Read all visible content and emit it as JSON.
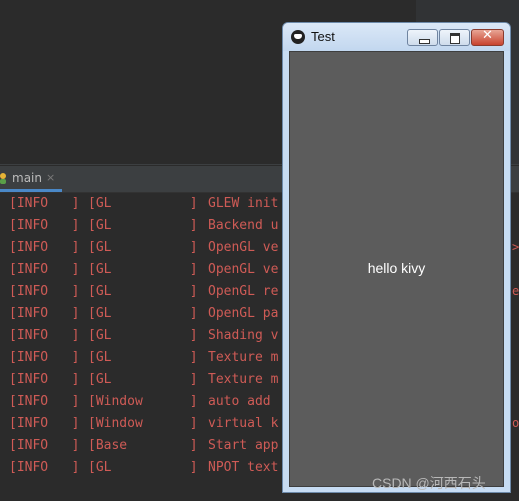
{
  "run_tab": {
    "label": "main",
    "close": "×"
  },
  "console": {
    "lines": [
      {
        "level": "[INFO   ]",
        "module": "[GL          ]",
        "message": "GLEW init"
      },
      {
        "level": "[INFO   ]",
        "module": "[GL          ]",
        "message": "Backend u"
      },
      {
        "level": "[INFO   ]",
        "module": "[GL          ]",
        "message": "OpenGL ve"
      },
      {
        "level": "[INFO   ]",
        "module": "[GL          ]",
        "message": "OpenGL ve"
      },
      {
        "level": "[INFO   ]",
        "module": "[GL          ]",
        "message": "OpenGL re"
      },
      {
        "level": "[INFO   ]",
        "module": "[GL          ]",
        "message": "OpenGL pa"
      },
      {
        "level": "[INFO   ]",
        "module": "[GL          ]",
        "message": "Shading v"
      },
      {
        "level": "[INFO   ]",
        "module": "[GL          ]",
        "message": "Texture m"
      },
      {
        "level": "[INFO   ]",
        "module": "[GL          ]",
        "message": "Texture m"
      },
      {
        "level": "[INFO   ]",
        "module": "[Window      ]",
        "message": "auto add"
      },
      {
        "level": "[INFO   ]",
        "module": "[Window      ]",
        "message": "virtual k"
      },
      {
        "level": "[INFO   ]",
        "module": "[Base        ]",
        "message": "Start app"
      },
      {
        "level": "[INFO   ]",
        "module": "[GL          ]",
        "message": "NPOT text"
      }
    ],
    "edge_marks": [
      ">",
      "e",
      "o"
    ]
  },
  "window": {
    "title": "Test",
    "close_glyph": "✕",
    "content_text": "hello kivy"
  },
  "watermark": "CSDN @河西石头"
}
